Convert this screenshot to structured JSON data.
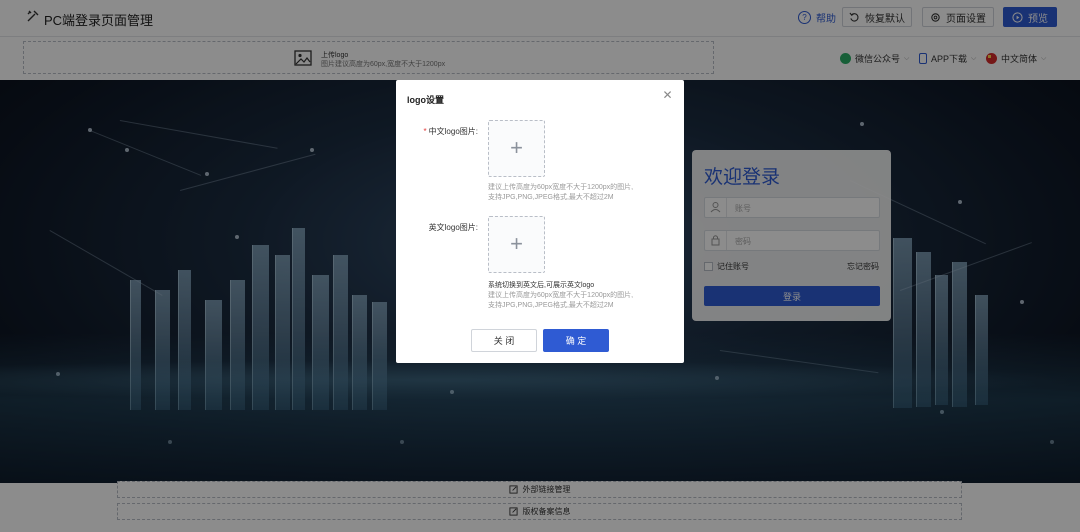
{
  "header": {
    "title": "PC端登录页面管理",
    "help": "帮助",
    "restore": "恢复默认",
    "settings": "页面设置",
    "preview": "预览"
  },
  "logo_upload": {
    "title": "上传logo",
    "hint": "图片建议高度为60px,宽度不大于1200px"
  },
  "top_right": {
    "wechat": "微信公众号",
    "app": "APP下载",
    "lang": "中文简体"
  },
  "login": {
    "title": "欢迎登录",
    "account_placeholder": "账号",
    "password_placeholder": "密码",
    "remember": "记住账号",
    "forgot": "忘记密码",
    "button": "登录"
  },
  "footer": {
    "external_links": "外部链接管理",
    "copyright": "版权备案信息"
  },
  "modal": {
    "title": "logo设置",
    "cn_label": "中文logo图片:",
    "cn_hint_1": "建议上传高度为60px宽度不大于1200px的图片,",
    "cn_hint_2": "支持JPG,PNG,JPEG格式,最大不超过2M",
    "en_label": "英文logo图片:",
    "en_note": "系统切换到英文后,可展示英文logo",
    "en_hint_1": "建议上传高度为60px宽度不大于1200px的图片,",
    "en_hint_2": "支持JPG,PNG,JPEG格式,最大不超过2M",
    "cancel": "关 闭",
    "confirm": "确 定",
    "required_mark": "*",
    "plus": "+"
  },
  "colors": {
    "accent": "#2f5bd3",
    "required": "#e23b3b"
  }
}
